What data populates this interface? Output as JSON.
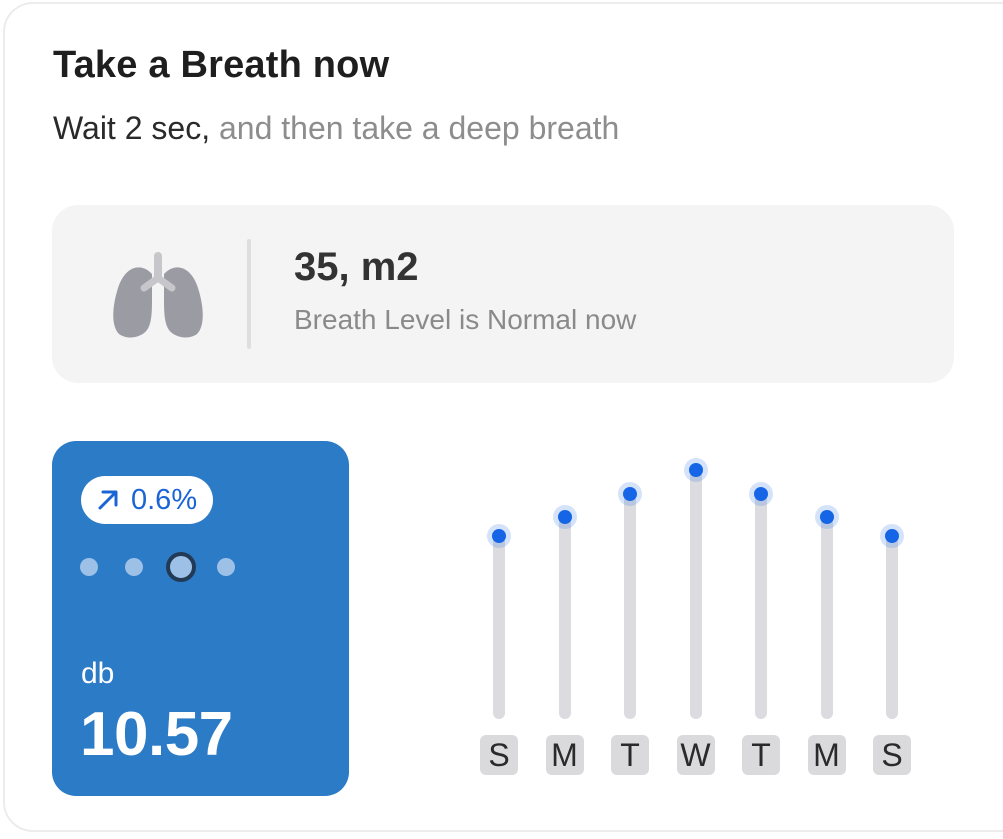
{
  "header": {
    "title": "Take a Breath now",
    "subtitle_dark": "Wait 2 sec,",
    "subtitle_light": "and then take a deep breath"
  },
  "breath_status": {
    "icon": "lungs-icon",
    "value": "35, m2",
    "description": "Breath Level is Normal now"
  },
  "db_card": {
    "change": "0.6%",
    "change_icon": "arrow-up-right-icon",
    "unit": "db",
    "value": "10.57",
    "pager": {
      "count": 4,
      "active_index": 2
    },
    "colors": {
      "background": "#2b7bc6",
      "accent": "#1a64d6"
    }
  },
  "chart_data": {
    "type": "bar",
    "categories": [
      "S",
      "M",
      "T",
      "W",
      "T",
      "M",
      "S"
    ],
    "values": [
      0.7,
      0.77,
      0.86,
      0.95,
      0.86,
      0.77,
      0.7
    ],
    "ylim": [
      0,
      1
    ],
    "colors": {
      "track": "#dcdce0",
      "marker": "#1665e6"
    }
  }
}
